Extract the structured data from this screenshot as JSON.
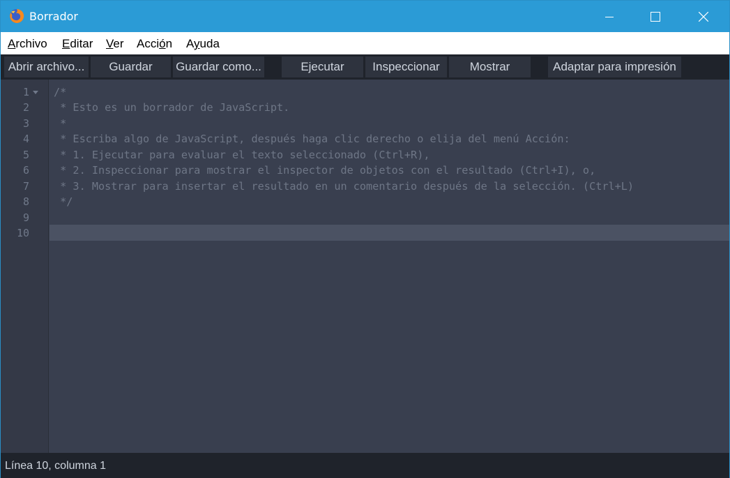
{
  "window": {
    "title": "Borrador",
    "icon": "firefox-icon"
  },
  "menu": {
    "items": [
      {
        "accel": "A",
        "rest": "rchivo"
      },
      {
        "accel": "E",
        "rest": "ditar"
      },
      {
        "accel": "V",
        "rest": "er"
      },
      {
        "pre": "Acci",
        "accel": "ó",
        "rest": "n"
      },
      {
        "pre": "A",
        "accel": "y",
        "rest": "uda"
      }
    ]
  },
  "toolbar": {
    "open": "Abrir archivo...",
    "save": "Guardar",
    "save_as": "Guardar como...",
    "run": "Ejecutar",
    "inspect": "Inspeccionar",
    "display": "Mostrar",
    "pretty_print": "Adaptar para impresión"
  },
  "editor": {
    "line_numbers": [
      "1",
      "2",
      "3",
      "4",
      "5",
      "6",
      "7",
      "8",
      "9",
      "10"
    ],
    "lines": [
      "/*",
      " * Esto es un borrador de JavaScript.",
      " *",
      " * Escriba algo de JavaScript, después haga clic derecho o elija del menú Acción:",
      " * 1. Ejecutar para evaluar el texto seleccionado (Ctrl+R),",
      " * 2. Inspeccionar para mostrar el inspector de objetos con el resultado (Ctrl+I), o,",
      " * 3. Mostrar para insertar el resultado en un comentario después de la selección. (Ctrl+L)",
      " */",
      "",
      ""
    ],
    "active_line": "10"
  },
  "status": {
    "text": "Línea 10, columna 1"
  },
  "colors": {
    "titlebar": "#2b9bd6",
    "editor_bg": "#393f4f",
    "comment": "#6e7686",
    "toolbar_bg": "#1f232b"
  }
}
